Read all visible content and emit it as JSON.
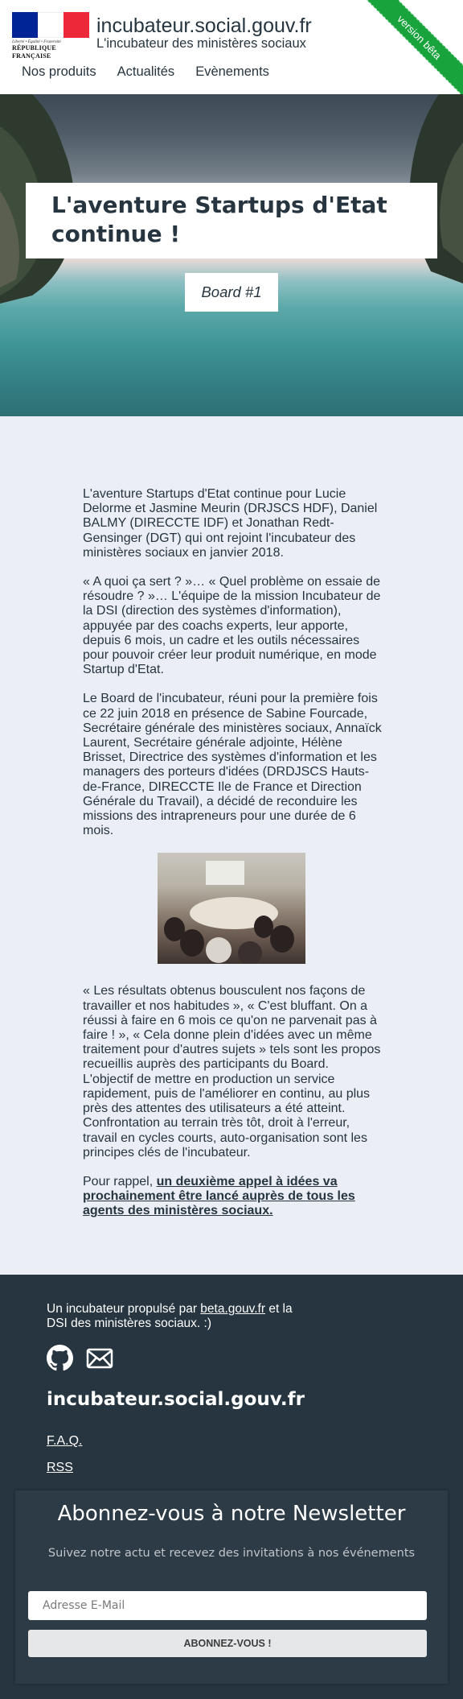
{
  "header": {
    "logo_devise": "Liberté • Égalité • Fraternité",
    "logo_text": "RÉPUBLIQUE FRANÇAISE",
    "site_title": "incubateur.social.gouv.fr",
    "site_subtitle": "L'incubateur des ministères sociaux",
    "beta_label": "version bêta",
    "nav": [
      "Nos produits",
      "Actualités",
      "Evènements"
    ],
    "flag_colors": [
      "#002395",
      "#ffffff",
      "#ed2939"
    ]
  },
  "hero": {
    "title": "L'aventure Startups d'Etat continue !",
    "badge": "Board #1"
  },
  "article": {
    "p1": "L'aventure Startups d'Etat continue pour Lucie Delorme et Jasmine Meurin (DRJSCS HDF), Daniel BALMY (DIRECCTE IDF) et Jonathan Redt-Gensinger (DGT) qui ont rejoint l'incubateur des ministères sociaux en janvier 2018.",
    "p2": "« A quoi ça sert ? »… « Quel problème on essaie de résoudre ? »… L'équipe de la mission Incubateur de la DSI (direction des systèmes d'information), appuyée par des coachs experts, leur apporte, depuis 6 mois, un cadre et les outils nécessaires pour pouvoir créer leur produit numérique, en mode Startup d'Etat.",
    "p3": "Le Board de l'incubateur, réuni pour la première fois ce 22 juin 2018 en présence de Sabine Fourcade, Secrétaire générale des ministères sociaux, Annaïck Laurent, Secrétaire générale adjointe, Hélène Brisset, Directrice des systèmes d'information et les managers des porteurs d'idées (DRDJSCS Hauts-de-France, DIRECCTE Ile de France et Direction Générale du Travail), a décidé de reconduire les missions des intrapreneurs pour une durée de 6 mois.",
    "p4": "« Les résultats obtenus bousculent nos façons de travailler et nos habitudes », « C'est bluffant. On a réussi à faire en 6 mois ce qu'on ne parvenait pas à faire ! », « Cela donne plein d'idées avec un même traitement pour d'autres sujets » tels sont les propos recueillis auprès des participants du Board. L'objectif de mettre en production un service rapidement, puis de l'améliorer en continu, au plus près des attentes des utilisateurs a été atteint. Confrontation au terrain très tôt, droit à l'erreur, travail en cycles courts, auto-organisation sont les principes clés de l'incubateur.",
    "p5_prefix": "Pour rappel, ",
    "p5_link": "un deuxième appel à idées va prochainement être lancé auprès de tous les agents des ministères sociaux."
  },
  "footer": {
    "tagline_prefix": "Un incubateur propulsé par ",
    "tagline_link": "beta.gouv.fr",
    "tagline_suffix": " et la DSI des ministères sociaux. :)",
    "icons": [
      "github-icon",
      "mail-icon"
    ],
    "brand": "incubateur.social.gouv.fr",
    "links": [
      "F.A.Q.",
      "RSS"
    ]
  },
  "newsletter": {
    "title": "Abonnez-vous à notre Newsletter",
    "subtitle": "Suivez notre actu et recevez des invitations à nos événements",
    "email_placeholder": "Adresse E-Mail",
    "submit_label": "ABONNEZ-VOUS !"
  }
}
